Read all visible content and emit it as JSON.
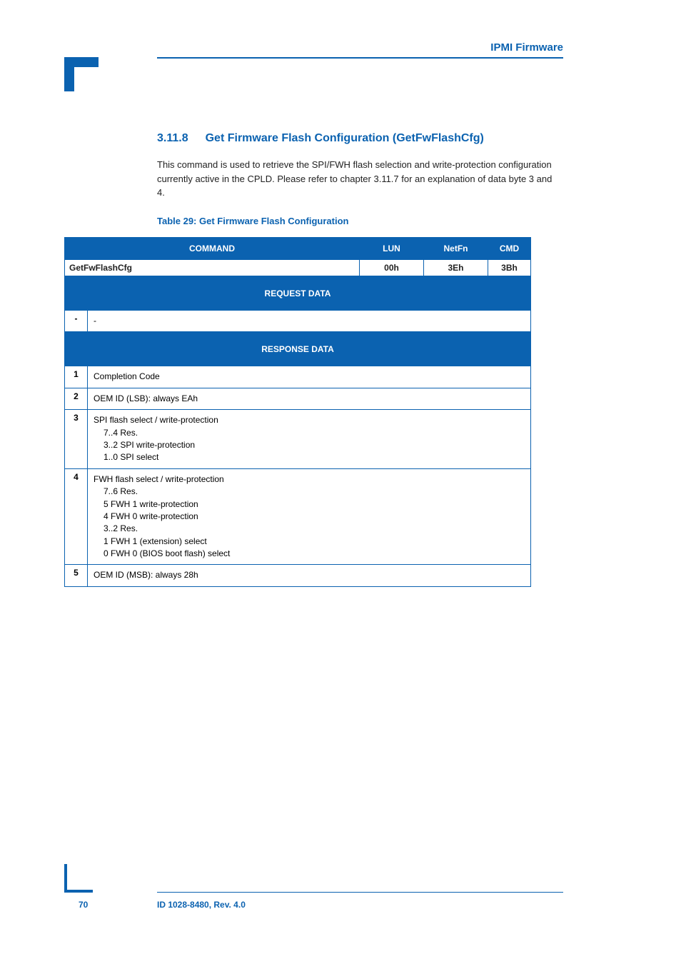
{
  "header_right": "IPMI Firmware",
  "section": {
    "num": "3.11.8",
    "title": "Get Firmware Flash Configuration (GetFwFlashCfg)"
  },
  "body_text": "This command is used to retrieve the SPI/FWH flash selection and write-protection configuration currently active in the CPLD. Please refer to chapter 3.11.7 for an explanation of data byte 3 and 4.",
  "table_caption": "Table 29: Get Firmware Flash Configuration",
  "top_headers": [
    "COMMAND",
    "LUN",
    "NetFn",
    "CMD"
  ],
  "cmd_row": [
    "GetFwFlashCfg",
    "00h",
    "3Eh",
    "3Bh"
  ],
  "request_header": "REQUEST DATA",
  "request_rows": [
    {
      "byte": "-",
      "desc": "-"
    }
  ],
  "response_header": "RESPONSE DATA",
  "response_rows": [
    {
      "byte": "1",
      "lines": [
        "Completion Code"
      ]
    },
    {
      "byte": "2",
      "lines": [
        "OEM ID (LSB): always EAh"
      ]
    },
    {
      "byte": "3",
      "lines": [
        "SPI flash select / write-protection",
        "7..4       Res.",
        "3..2       SPI write-protection",
        "1..0       SPI select"
      ]
    },
    {
      "byte": "4",
      "lines": [
        "FWH flash select / write-protection",
        "7..6       Res.",
        "5           FWH 1 write-protection",
        "4           FWH 0 write-protection",
        "3..2       Res.",
        "1           FWH 1 (extension) select",
        "0           FWH 0 (BIOS boot flash) select"
      ]
    },
    {
      "byte": "5",
      "lines": [
        "OEM ID (MSB): always 28h"
      ]
    }
  ],
  "footer": {
    "page": "70",
    "text": "ID 1028-8480, Rev. 4.0"
  }
}
